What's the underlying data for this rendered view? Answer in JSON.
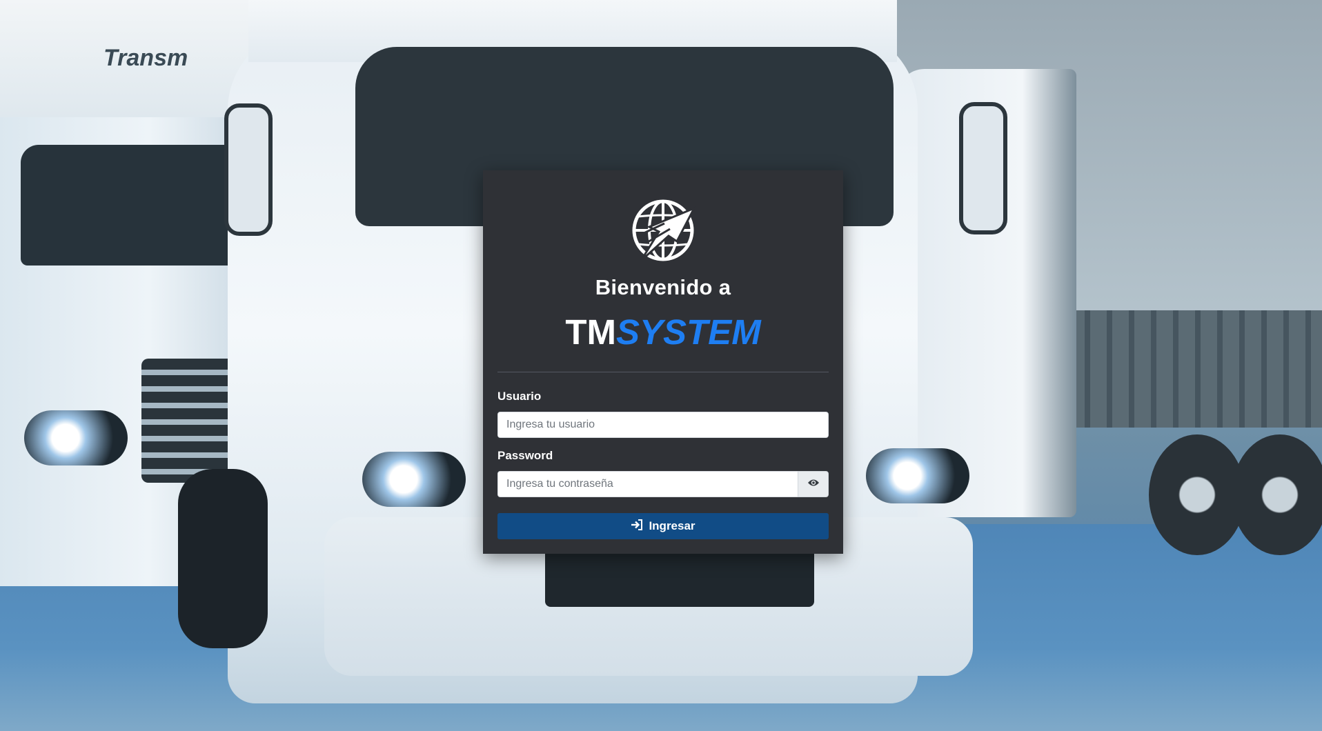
{
  "background": {
    "description_icon": "trucks-photo",
    "truck_brand_text": "Transm"
  },
  "login": {
    "logo_icon": "globe-plane-logo-icon",
    "welcome": "Bienvenido a",
    "brand_primary": "TM",
    "brand_secondary": "SYSTEM",
    "username_label": "Usuario",
    "username_placeholder": "Ingresa tu usuario",
    "password_label": "Password",
    "password_placeholder": "Ingresa tu contraseña",
    "toggle_password_icon": "eye-icon",
    "submit_icon": "sign-in-icon",
    "submit_label": "Ingresar"
  },
  "colors": {
    "card_bg": "#2f3136",
    "accent": "#1e7ef2",
    "button_bg": "#114c86"
  }
}
